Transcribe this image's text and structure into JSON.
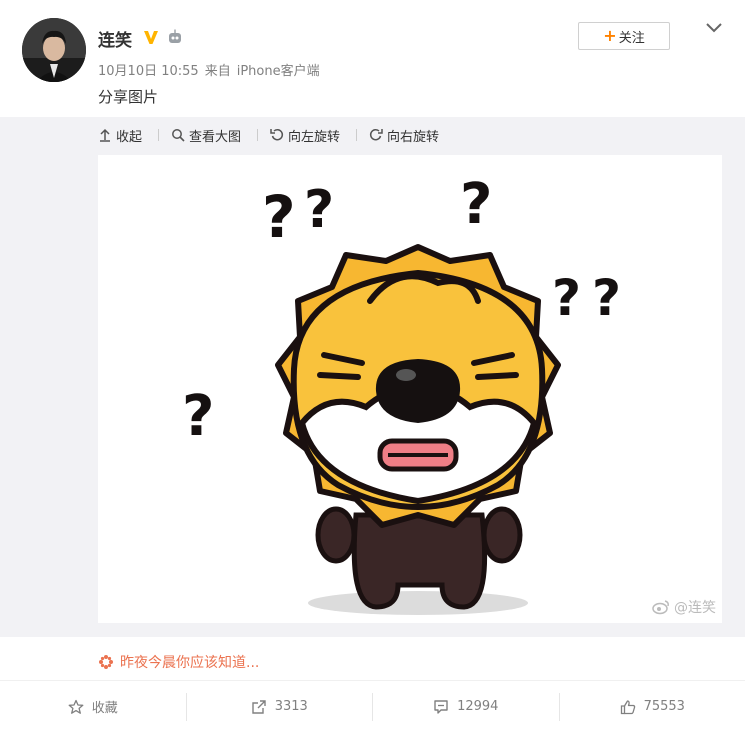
{
  "post": {
    "username": "连笑",
    "time": "10月10日 10:55",
    "source_prefix": "来自",
    "source": "iPhone客户端",
    "text": "分享图片"
  },
  "follow_button": {
    "label": "关注"
  },
  "toolbar": {
    "collapse": "收起",
    "view_large": "查看大图",
    "rotate_left": "向左旋转",
    "rotate_right": "向右旋转"
  },
  "image": {
    "watermark": "@连笑",
    "marks": [
      "?",
      "?",
      "?",
      "?",
      "?",
      "?"
    ]
  },
  "footer_link": {
    "text": "昨夜今晨你应该知道..."
  },
  "actions": {
    "favorite": "收藏",
    "repost_count": "3313",
    "comment_count": "12994",
    "like_count": "75553"
  },
  "colors": {
    "accent": "#ff8200",
    "link": "#eb7350",
    "lion": "#f7b731"
  }
}
